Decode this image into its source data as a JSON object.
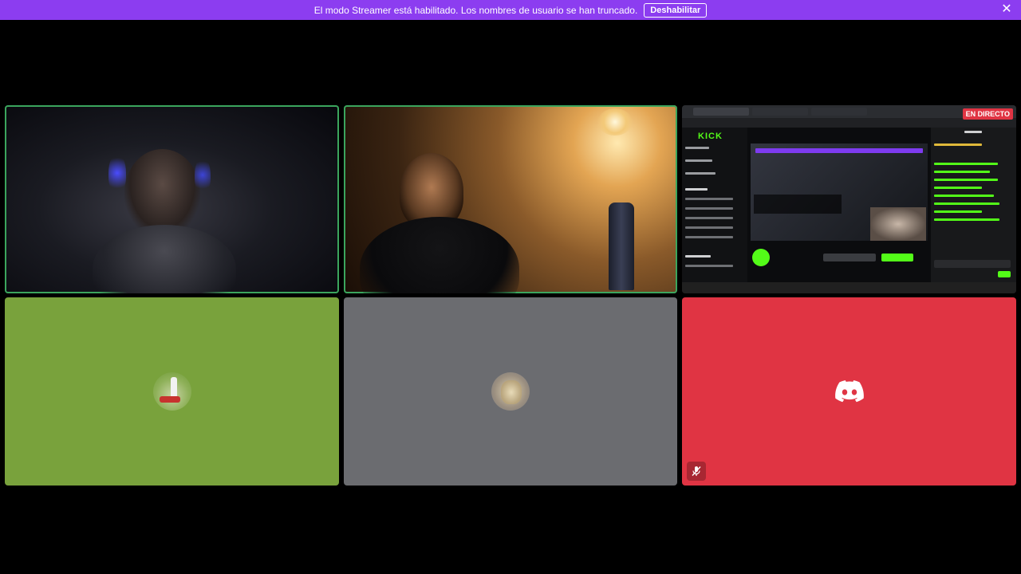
{
  "banner": {
    "message": "El modo Streamer está habilitado. Los nombres de usuario se han truncado.",
    "disable_label": "Deshabilitar",
    "close_icon": "close-icon",
    "color": "#8c3df0"
  },
  "tiles": {
    "screen_share": {
      "live_badge": "EN DIRECTO",
      "brand_logo": "KICK"
    },
    "mic_muted_icon": "mic-muted-icon",
    "speaking_outline_color": "#3ba55d",
    "discord_red": "#e03443"
  }
}
